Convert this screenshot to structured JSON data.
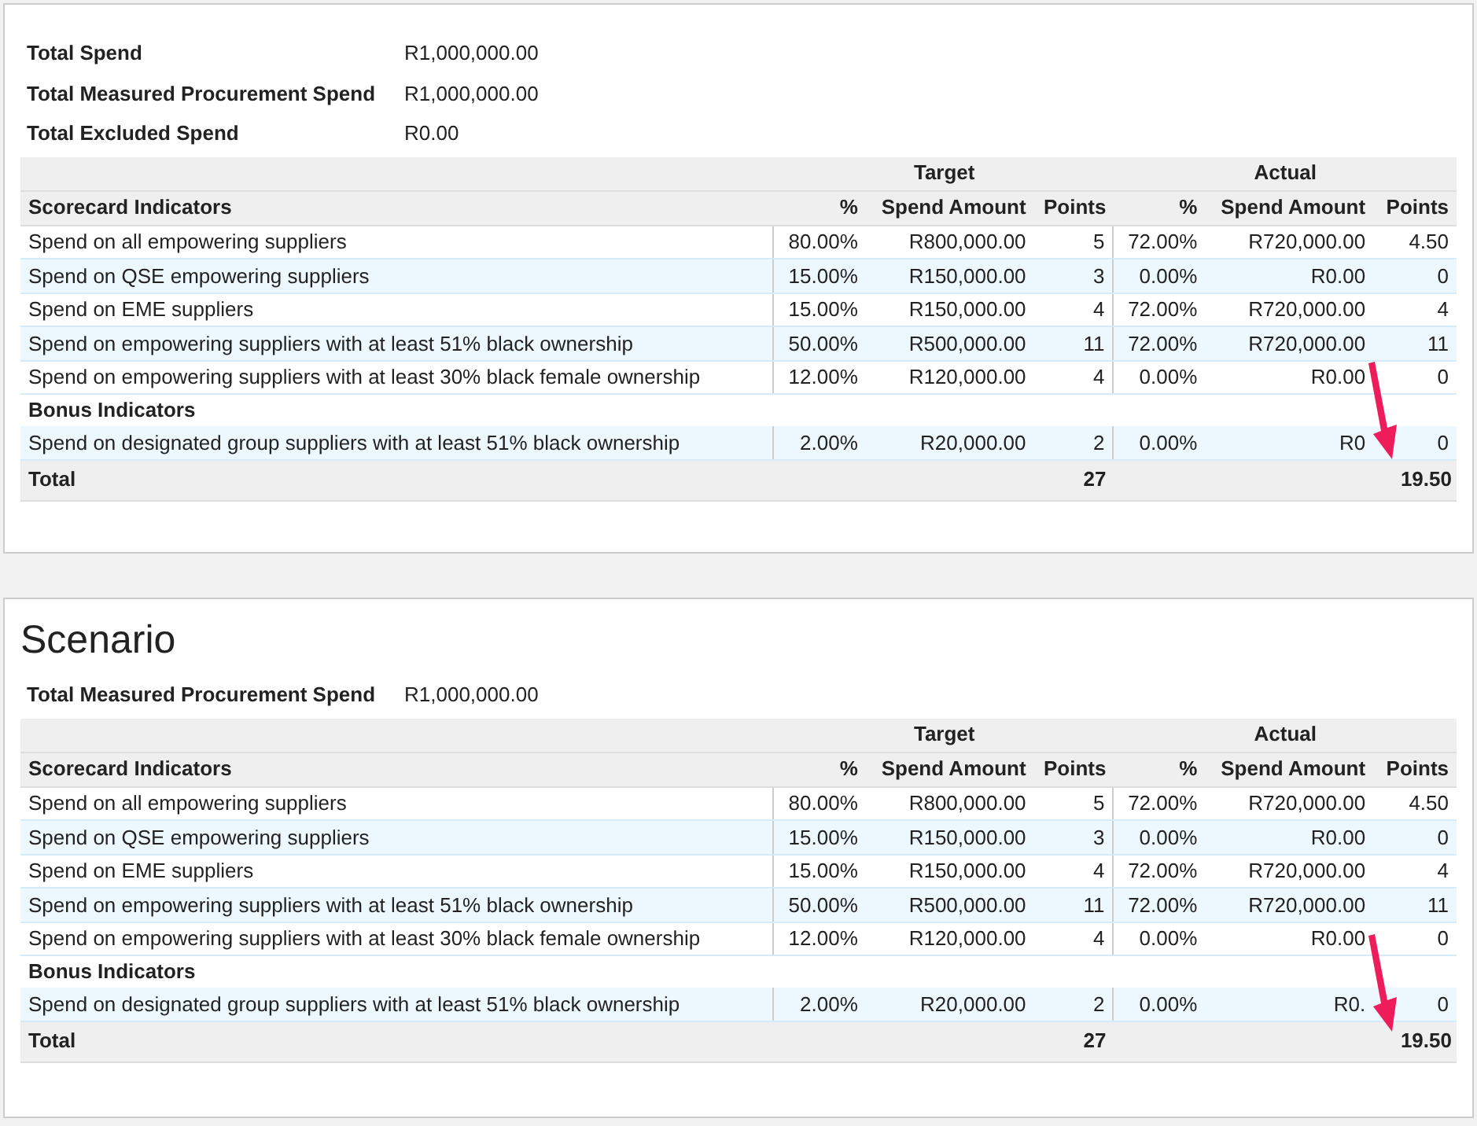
{
  "panels": [
    {
      "summary": [
        {
          "label": "Total Spend",
          "value": "R1,000,000.00"
        },
        {
          "label": "Total Measured Procurement Spend",
          "value": "R1,000,000.00"
        },
        {
          "label": "Total Excluded Spend",
          "value": "R0.00"
        }
      ],
      "table": {
        "groups": [
          "Target",
          "Actual"
        ],
        "columns": [
          "Scorecard Indicators",
          "%",
          "Spend Amount",
          "Points",
          "%",
          "Spend Amount",
          "Points"
        ],
        "sections": [
          {
            "rows": [
              [
                "Spend on all empowering suppliers",
                "80.00%",
                "R800,000.00",
                "5",
                "72.00%",
                "R720,000.00",
                "4.50"
              ],
              [
                "Spend on QSE empowering suppliers",
                "15.00%",
                "R150,000.00",
                "3",
                "0.00%",
                "R0.00",
                "0"
              ],
              [
                "Spend on EME suppliers",
                "15.00%",
                "R150,000.00",
                "4",
                "72.00%",
                "R720,000.00",
                "4"
              ],
              [
                "Spend on empowering suppliers with at least 51% black ownership",
                "50.00%",
                "R500,000.00",
                "11",
                "72.00%",
                "R720,000.00",
                "11"
              ],
              [
                "Spend on empowering suppliers with at least 30% black female ownership",
                "12.00%",
                "R120,000.00",
                "4",
                "0.00%",
                "R0.00",
                "0"
              ]
            ]
          },
          {
            "heading": "Bonus Indicators",
            "rows": [
              [
                "Spend on designated group suppliers with at least 51% black ownership",
                "2.00%",
                "R20,000.00",
                "2",
                "0.00%",
                "R0",
                "0"
              ]
            ]
          }
        ],
        "total": {
          "label": "Total",
          "target_points": "27",
          "actual_points": "19.50"
        }
      }
    },
    {
      "title": "Scenario",
      "summary": [
        {
          "label": "Total Measured Procurement Spend",
          "value": "R1,000,000.00"
        }
      ],
      "table": {
        "groups": [
          "Target",
          "Actual"
        ],
        "columns": [
          "Scorecard Indicators",
          "%",
          "Spend Amount",
          "Points",
          "%",
          "Spend Amount",
          "Points"
        ],
        "sections": [
          {
            "rows": [
              [
                "Spend on all empowering suppliers",
                "80.00%",
                "R800,000.00",
                "5",
                "72.00%",
                "R720,000.00",
                "4.50"
              ],
              [
                "Spend on QSE empowering suppliers",
                "15.00%",
                "R150,000.00",
                "3",
                "0.00%",
                "R0.00",
                "0"
              ],
              [
                "Spend on EME suppliers",
                "15.00%",
                "R150,000.00",
                "4",
                "72.00%",
                "R720,000.00",
                "4"
              ],
              [
                "Spend on empowering suppliers with at least 51% black ownership",
                "50.00%",
                "R500,000.00",
                "11",
                "72.00%",
                "R720,000.00",
                "11"
              ],
              [
                "Spend on empowering suppliers with at least 30% black female ownership",
                "12.00%",
                "R120,000.00",
                "4",
                "0.00%",
                "R0.00",
                "0"
              ]
            ]
          },
          {
            "heading": "Bonus Indicators",
            "rows": [
              [
                "Spend on designated group suppliers with at least 51% black ownership",
                "2.00%",
                "R20,000.00",
                "2",
                "0.00%",
                "R0.",
                "0"
              ]
            ]
          }
        ],
        "total": {
          "label": "Total",
          "target_points": "27",
          "actual_points": "19.50"
        }
      }
    }
  ]
}
